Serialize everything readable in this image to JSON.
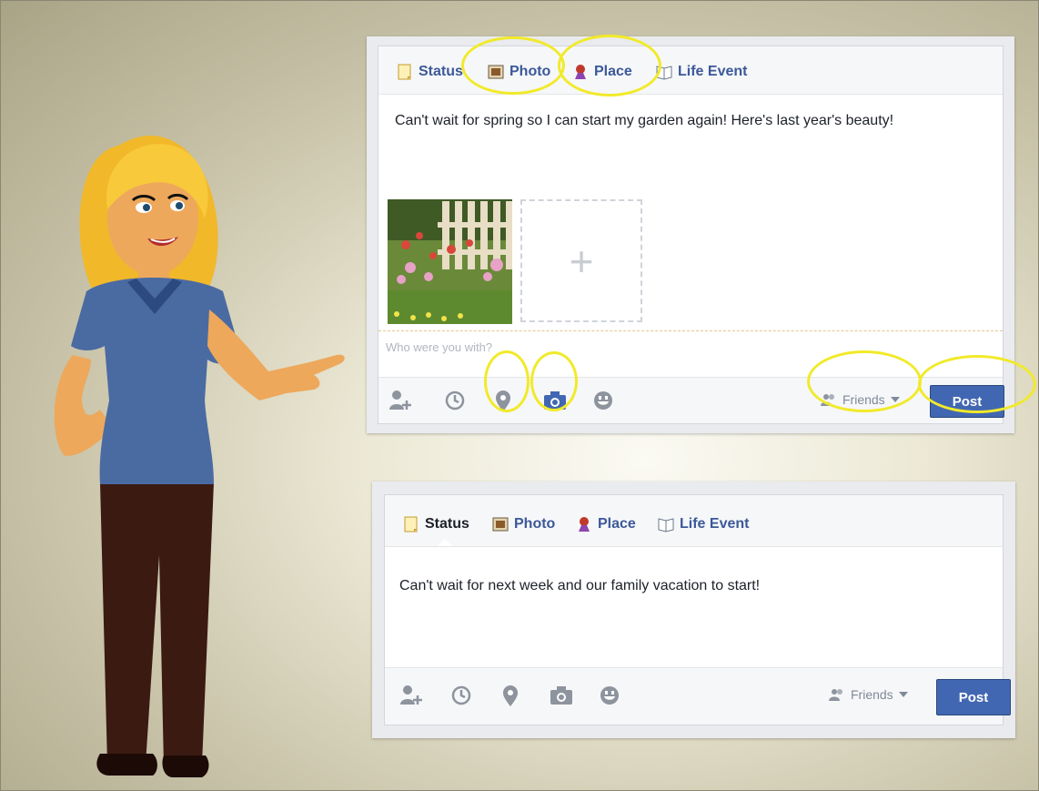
{
  "top_composer": {
    "tabs": [
      "Status",
      "Photo",
      "Place",
      "Life Event"
    ],
    "text": "Can't wait for spring so I can start my garden again! Here's last year's beauty!",
    "add_photo_symbol": "+",
    "with_placeholder": "Who were you with?",
    "audience": "Friends",
    "post_label": "Post",
    "highlight_color": "#f1ea2a",
    "camera_active_color": "#4267b2"
  },
  "bottom_composer": {
    "tabs": [
      "Status",
      "Photo",
      "Place",
      "Life Event"
    ],
    "text": "Can't wait for next week and our family vacation to start!",
    "audience": "Friends",
    "post_label": "Post"
  },
  "toolbar_icons": [
    "tag-friends-icon",
    "clock-icon",
    "location-pin-icon",
    "camera-icon",
    "smiley-icon"
  ],
  "colors": {
    "link_blue": "#3b5998",
    "button_blue": "#4267b2",
    "text_dark": "#1d2129"
  }
}
